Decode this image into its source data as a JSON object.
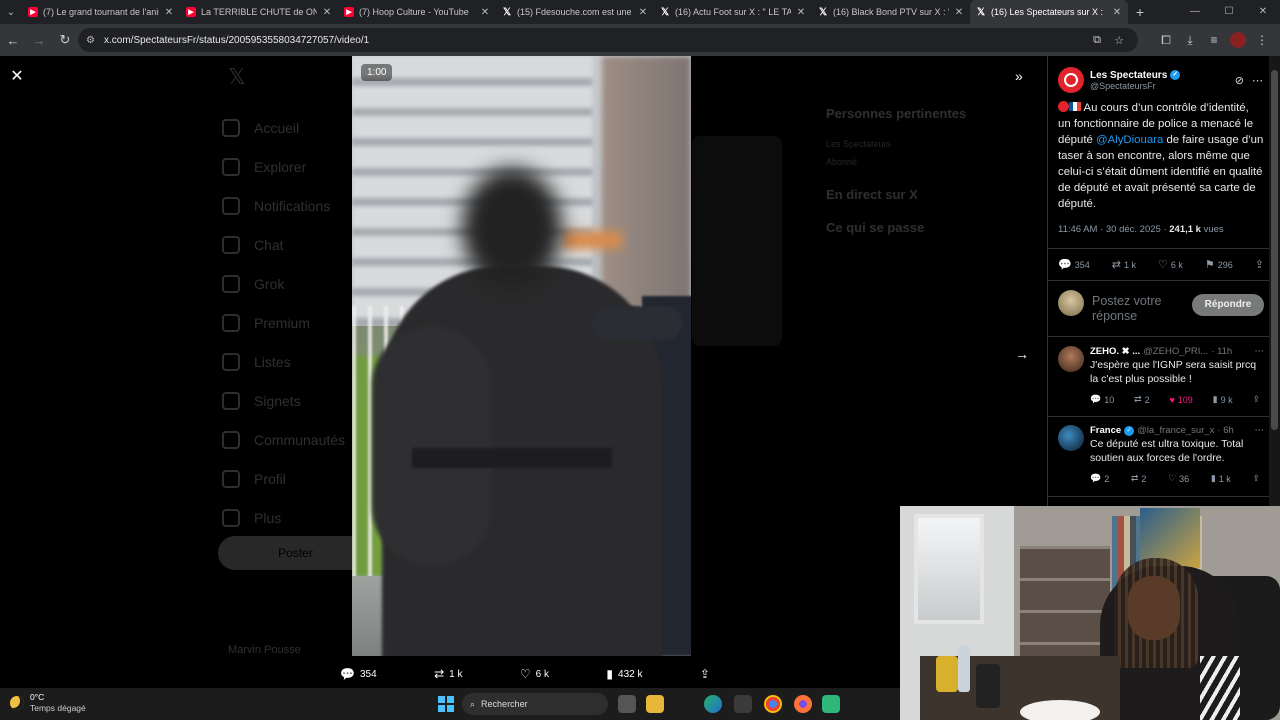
{
  "browser": {
    "tabs": [
      {
        "title": "(7) Le grand tournant de l'anim",
        "favicon": "youtube-icon",
        "active": false
      },
      {
        "title": "La TERRIBLE CHUTE de ONE PU",
        "favicon": "youtube-icon",
        "active": false
      },
      {
        "title": "(7) Hoop Culture - YouTube",
        "favicon": "youtube-icon",
        "active": false
      },
      {
        "title": "(15) Fdesouche.com est une re",
        "favicon": "x-icon",
        "active": false
      },
      {
        "title": "(16) Actu Foot sur X : \" LE TA",
        "favicon": "x-icon",
        "active": false
      },
      {
        "title": "(16) Black Bond PTV sur X : \"Le",
        "favicon": "x-icon",
        "active": false
      },
      {
        "title": "(16) Les Spectateurs sur X :",
        "favicon": "x-icon",
        "active": true
      }
    ],
    "url": "x.com/SpectateursFr/status/2005953558034727057/video/1"
  },
  "background": {
    "nav_items": [
      "Accueil",
      "Explorer",
      "Notifications",
      "Chat",
      "Grok",
      "Premium",
      "Listes",
      "Signets",
      "Communautés",
      "Profil",
      "Plus"
    ],
    "post_button": "Poster",
    "relevant_title": "Personnes pertinentes",
    "live_title": "En direct sur X",
    "happening_title": "Ce qui se passe",
    "follow_label": "Abonné",
    "user_name": "Marvin Pousse"
  },
  "video": {
    "timestamp": "1:00",
    "actions": {
      "replies": "354",
      "reposts": "1 k",
      "likes": "6 k",
      "views": "432 k"
    }
  },
  "post": {
    "author_name": "Les Spectateurs",
    "author_handle": "@SpectateursFr",
    "text_before_mention": "Au cours d’un contrôle d’identité, un fonctionnaire de police a menacé le député ",
    "mention": "@AlyDiouara",
    "text_after_mention": " de faire usage d’un taser à son encontre, alors même que celui-ci s’était dûment identifié en qualité de député et avait présenté sa carte de député.",
    "time": "11:46 AM · 30 déc. 2025 · ",
    "views_count": "241,1 k",
    "views_label": " vues",
    "stats": {
      "replies": "354",
      "reposts": "1 k",
      "likes": "6 k",
      "bookmarks": "296"
    },
    "reply_placeholder": "Postez votre réponse",
    "reply_button": "Répondre"
  },
  "comments": [
    {
      "name": "ZEHO. ✖ ...",
      "handle": "@ZEHO_PRI...",
      "time": "· 11h",
      "text": "J'espère que l'IGNP sera saisit prcq la c'est plus possible !",
      "replies": "10",
      "reposts": "2",
      "likes": "109",
      "views": "9 k"
    },
    {
      "name": "France",
      "handle": "@la_france_sur_x",
      "time": "· 6h",
      "text": "Ce député est ultra toxique. Total soutien aux forces de l'ordre.",
      "replies": "2",
      "reposts": "2",
      "likes": "36",
      "views": "1 k"
    }
  ],
  "taskbar": {
    "temperature": "0°C",
    "weather": "Temps dégagé",
    "search_label": "Rechercher"
  },
  "colors": {
    "accent": "#1d9bf0",
    "like_pink": "#f91880",
    "brand_red": "#e0242e"
  }
}
